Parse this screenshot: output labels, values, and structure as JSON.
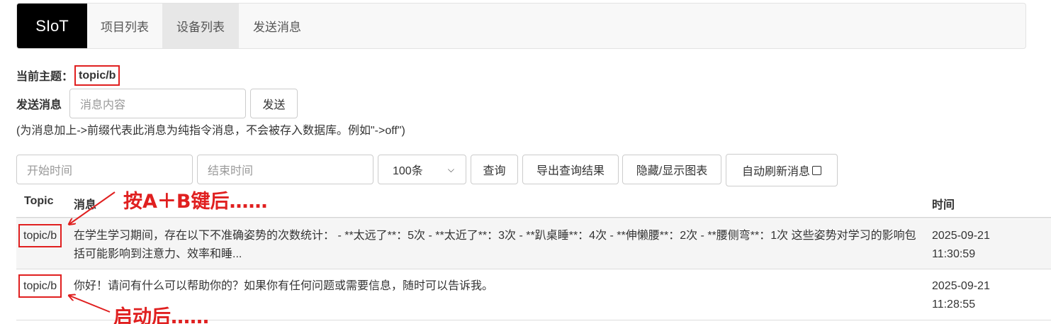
{
  "navbar": {
    "brand": "SIoT",
    "items": [
      {
        "label": "项目列表",
        "active": false
      },
      {
        "label": "设备列表",
        "active": true
      },
      {
        "label": "发送消息",
        "active": false
      }
    ]
  },
  "topic": {
    "label": "当前主题：",
    "value": "topic/b"
  },
  "send": {
    "label": "发送消息",
    "input_placeholder": "消息内容",
    "button": "发送",
    "hint": "(为消息加上->前缀代表此消息为纯指令消息，不会被存入数据库。例如\"->off\")"
  },
  "filters": {
    "start_placeholder": "开始时间",
    "end_placeholder": "结束时间",
    "limit_selected": "100条",
    "query_button": "查询",
    "export_button": "导出查询结果",
    "toggle_chart_button": "隐藏/显示图表",
    "auto_refresh_label": "自动刷新消息",
    "auto_refresh_checked": false
  },
  "table": {
    "headers": [
      "Topic",
      "消息",
      "时间"
    ],
    "rows": [
      {
        "topic": "topic/b",
        "message": "在学生学习期间，存在以下不准确姿势的次数统计： - **太远了**：5次 - **太近了**：3次 - **趴桌睡**：4次 - **伸懒腰**：2次 - **腰侧弯**：1次 这些姿势对学习的影响包括可能影响到注意力、效率和睡...",
        "time_date": "2025-09-21",
        "time_clock": "11:30:59"
      },
      {
        "topic": "topic/b",
        "message": "你好！请问有什么可以帮助你的？如果你有任何问题或需要信息，随时可以告诉我。",
        "time_date": "2025-09-21",
        "time_clock": "11:28:55"
      }
    ]
  },
  "annotations": {
    "first": "按A＋B键后……",
    "second": "启动后……",
    "color": "#e02020"
  }
}
